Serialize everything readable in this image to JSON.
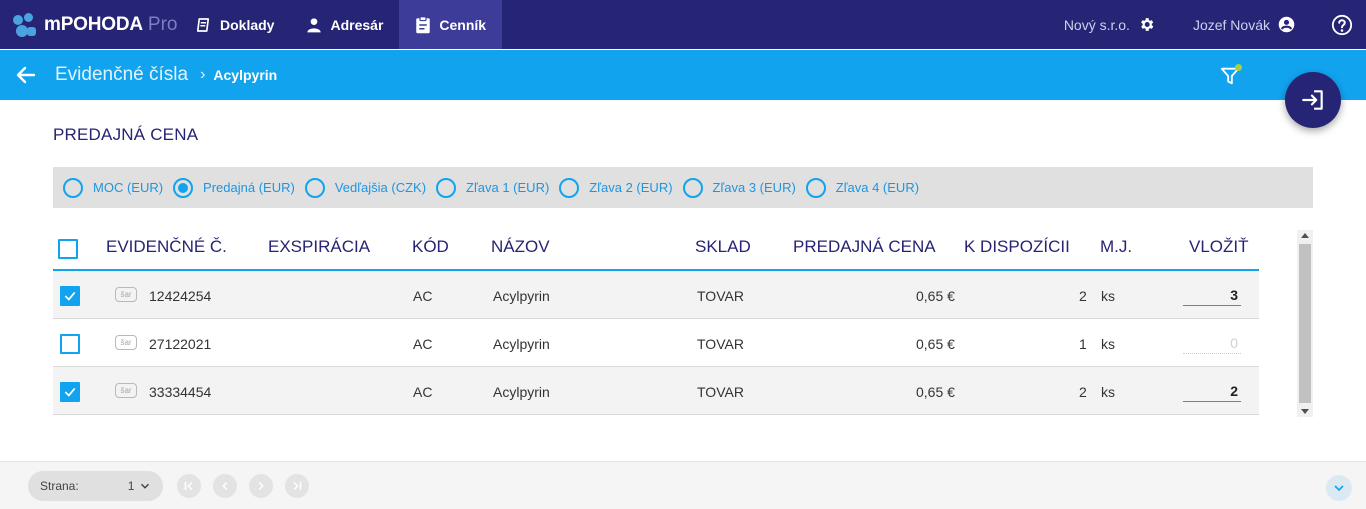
{
  "app": {
    "name": "mPOHODA",
    "edition": "Pro"
  },
  "nav": [
    {
      "label": "Doklady",
      "icon": "documents-icon"
    },
    {
      "label": "Adresár",
      "icon": "person-icon"
    },
    {
      "label": "Cenník",
      "icon": "clipboard-icon",
      "active": true
    }
  ],
  "header_right": {
    "company": "Nový s.r.o.",
    "user": "Jozef Novák"
  },
  "breadcrumb": {
    "title": "Evidenčné čísla",
    "current": "Acylpyrin"
  },
  "section_title": "PREDAJNÁ CENA",
  "price_types": [
    {
      "label": "MOC (EUR)",
      "selected": false
    },
    {
      "label": "Predajná (EUR)",
      "selected": true
    },
    {
      "label": "Vedľajšia (CZK)",
      "selected": false
    },
    {
      "label": "Zľava 1 (EUR)",
      "selected": false
    },
    {
      "label": "Zľava 2 (EUR)",
      "selected": false
    },
    {
      "label": "Zľava 3 (EUR)",
      "selected": false
    },
    {
      "label": "Zľava 4 (EUR)",
      "selected": false
    }
  ],
  "columns": {
    "ev": "EVIDENČNÉ Č.",
    "exp": "EXSPIRÁCIA",
    "code": "KÓD",
    "name": "NÁZOV",
    "store": "SKLAD",
    "price": "PREDAJNÁ CENA",
    "avail": "K DISPOZÍCII",
    "unit": "M.J.",
    "insert": "VLOŽIŤ"
  },
  "rows": [
    {
      "checked": true,
      "badge": "šar",
      "ev": "12424254",
      "exp": "",
      "code": "AC",
      "name": "Acylpyrin",
      "store": "TOVAR",
      "price": "0,65 €",
      "avail": "2",
      "unit": "ks",
      "qty": "3"
    },
    {
      "checked": false,
      "badge": "šar",
      "ev": "27122021",
      "exp": "",
      "code": "AC",
      "name": "Acylpyrin",
      "store": "TOVAR",
      "price": "0,65 €",
      "avail": "1",
      "unit": "ks",
      "qty": "0"
    },
    {
      "checked": true,
      "badge": "šar",
      "ev": "33334454",
      "exp": "",
      "code": "AC",
      "name": "Acylpyrin",
      "store": "TOVAR",
      "price": "0,65 €",
      "avail": "2",
      "unit": "ks",
      "qty": "2"
    }
  ],
  "footer": {
    "page_label": "Strana:",
    "page_value": "1"
  },
  "colors": {
    "topbar": "#262474",
    "accent": "#12a3ef",
    "active_nav": "#3d3c99"
  }
}
